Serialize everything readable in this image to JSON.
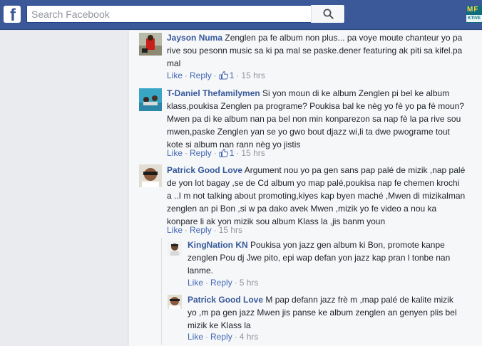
{
  "header": {
    "logo_letter": "f",
    "search_placeholder": "Search Facebook",
    "right_logo_top": "MF",
    "right_logo_bottom": "KTIVE"
  },
  "comments": [
    {
      "author": "Jayson Numa",
      "text": "Zenglen pa fe album non plus... pa voye moute chanteur yo pa rive sou pesonn music sa ki pa mal se paske.dener featuring ak piti sa kifel.pa mal",
      "like_label": "Like",
      "reply_label": "Reply",
      "likes": "1",
      "time": "15 hrs"
    },
    {
      "author": "T-Daniel Thefamilymen",
      "text": "Si yon moun di ke album Zenglen pi bel ke album klass,poukisa Zenglen pa programe? Poukisa bal ke nèg yo fè yo pa fè moun? Mwen pa di ke album nan pa bel non min konparezon sa nap fè la pa rive sou mwen,paske Zenglen yan se yo gwo bout djazz wi,li ta dwe pwograme tout kote si album nan rann nèg yo jistis",
      "like_label": "Like",
      "reply_label": "Reply",
      "likes": "1",
      "time": "15 hrs"
    },
    {
      "author": "Patrick Good Love",
      "text": "Argument nou yo pa gen sans pap palé de mizik ,nap palé de yon lot bagay ,se de Cd album yo map palé,poukisa nap fe chemen krochi a ..I m not talking about promoting,kiyes kap byen maché ,Mwen di mizikalman zenglen an pi Bon ,si w pa dako avek Mwen ,mizik yo fe video a nou ka konpare li ak yon mizik sou album Klass la ,jis banm youn",
      "like_label": "Like",
      "reply_label": "Reply",
      "time": "15 hrs"
    }
  ],
  "replies": [
    {
      "author": "KingNation KN",
      "text": "Poukisa yon jazz gen album ki Bon, promote kanpe zenglen Pou dj Jwe pito, epi wap defan yon jazz kap pran l tonbe nan lanme.",
      "like_label": "Like",
      "reply_label": "Reply",
      "time": "5 hrs"
    },
    {
      "author": "Patrick Good Love",
      "text": "M pap defann jazz frè m ,map palé de kalite mizik yo ,m pa gen jazz Mwen jis panse ke album zenglen an genyen plis bel mizik ke Klass la",
      "like_label": "Like",
      "reply_label": "Reply",
      "time": "4 hrs"
    }
  ],
  "colors": {
    "brand_blue": "#3b5998",
    "link_blue": "#365899",
    "meta_gray": "#90949c",
    "background": "#e9ebee"
  }
}
